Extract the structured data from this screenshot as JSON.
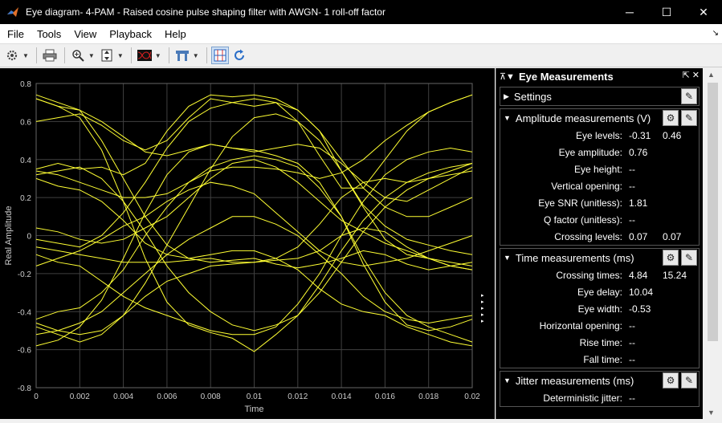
{
  "window": {
    "title": "Eye diagram- 4-PAM - Raised cosine pulse shaping filter with AWGN- 1 roll-off factor",
    "minimize": "─",
    "maximize": "☐",
    "close": "✕"
  },
  "menu": [
    "File",
    "Tools",
    "View",
    "Playback",
    "Help"
  ],
  "menu_overflow": "↘",
  "toolbar": {
    "icons": [
      "gear-icon",
      "print-icon",
      "zoom-in-icon",
      "scale-axes-icon",
      "eye-diagram-style-icon",
      "measurements-icon",
      "eye-measurements-icon",
      "refresh-icon"
    ]
  },
  "chart_data": {
    "type": "line",
    "title": "",
    "xlabel": "Time",
    "ylabel": "Real Amplitude",
    "xlim": [
      0,
      0.02
    ],
    "ylim": [
      -0.8,
      0.8
    ],
    "xticks": [
      "0",
      "0.002",
      "0.004",
      "0.006",
      "0.008",
      "0.01",
      "0.012",
      "0.014",
      "0.016",
      "0.018",
      "0.02"
    ],
    "yticks": [
      "-0.8",
      "-0.6",
      "-0.4",
      "-0.2",
      "0",
      "0.2",
      "0.4",
      "0.6",
      "0.8"
    ],
    "grid": true,
    "background": "#000000",
    "line_color": "#ffff33",
    "levels": [
      -0.46,
      -0.15,
      0.15,
      0.46
    ],
    "x": [
      0,
      0.001,
      0.002,
      0.003,
      0.004,
      0.005,
      0.006,
      0.007,
      0.008,
      0.009,
      0.01,
      0.011,
      0.012,
      0.013,
      0.014,
      0.015,
      0.016,
      0.017,
      0.018,
      0.019,
      0.02
    ],
    "series": [
      {
        "values": [
          0.72,
          0.68,
          0.62,
          0.45,
          0.18,
          -0.12,
          -0.35,
          -0.47,
          -0.51,
          -0.54,
          -0.61,
          -0.52,
          -0.42,
          -0.26,
          -0.08,
          0.08,
          0.2,
          0.28,
          0.33,
          0.36,
          0.38
        ]
      },
      {
        "values": [
          0.74,
          0.7,
          0.66,
          0.5,
          0.3,
          0.1,
          -0.05,
          -0.12,
          -0.14,
          -0.13,
          -0.12,
          -0.15,
          -0.17,
          -0.15,
          -0.12,
          -0.08,
          -0.1,
          -0.15,
          -0.18,
          -0.16,
          -0.14
        ]
      },
      {
        "values": [
          0.72,
          0.68,
          0.66,
          0.6,
          0.52,
          0.44,
          0.42,
          0.45,
          0.48,
          0.46,
          0.45,
          0.42,
          0.38,
          0.28,
          0.1,
          -0.15,
          -0.35,
          -0.47,
          -0.5,
          -0.48,
          -0.44
        ]
      },
      {
        "values": [
          0.6,
          0.62,
          0.64,
          0.58,
          0.5,
          0.45,
          0.5,
          0.62,
          0.72,
          0.7,
          0.68,
          0.7,
          0.6,
          0.42,
          0.25,
          0.25,
          0.4,
          0.55,
          0.65,
          0.7,
          0.74
        ]
      },
      {
        "values": [
          0.35,
          0.38,
          0.35,
          0.36,
          0.32,
          0.38,
          0.55,
          0.68,
          0.74,
          0.73,
          0.74,
          0.72,
          0.66,
          0.55,
          0.34,
          0.16,
          0.05,
          -0.02,
          -0.05,
          -0.08,
          -0.1
        ]
      },
      {
        "values": [
          0.34,
          0.32,
          0.28,
          0.24,
          0.2,
          0.2,
          0.22,
          0.28,
          0.36,
          0.4,
          0.42,
          0.4,
          0.36,
          0.25,
          0.1,
          -0.12,
          -0.3,
          -0.42,
          -0.48,
          -0.52,
          -0.56
        ]
      },
      {
        "values": [
          0.3,
          0.26,
          0.24,
          0.18,
          0.08,
          -0.04,
          -0.1,
          -0.12,
          -0.1,
          -0.08,
          -0.08,
          -0.12,
          -0.18,
          -0.28,
          -0.36,
          -0.4,
          -0.42,
          -0.48,
          -0.52,
          -0.56,
          -0.58
        ]
      },
      {
        "values": [
          0.32,
          0.34,
          0.36,
          0.3,
          0.18,
          0.02,
          -0.16,
          -0.3,
          -0.4,
          -0.47,
          -0.5,
          -0.47,
          -0.42,
          -0.3,
          -0.14,
          0.02,
          0.15,
          0.24,
          0.3,
          0.32,
          0.34
        ]
      },
      {
        "values": [
          0.04,
          0.02,
          -0.02,
          -0.04,
          -0.02,
          0.04,
          0.1,
          0.2,
          0.3,
          0.38,
          0.4,
          0.36,
          0.28,
          0.18,
          0.08,
          0.02,
          -0.04,
          -0.08,
          -0.12,
          -0.16,
          -0.18
        ]
      },
      {
        "values": [
          -0.02,
          -0.04,
          -0.06,
          0.0,
          0.12,
          0.28,
          0.46,
          0.6,
          0.67,
          0.7,
          0.72,
          0.7,
          0.66,
          0.55,
          0.4,
          0.25,
          0.15,
          0.1,
          0.1,
          0.15,
          0.2
        ]
      },
      {
        "values": [
          -0.06,
          -0.08,
          -0.1,
          -0.12,
          -0.14,
          -0.14,
          -0.14,
          -0.13,
          -0.12,
          -0.14,
          -0.14,
          -0.13,
          -0.12,
          -0.08,
          0.0,
          0.04,
          0.02,
          -0.06,
          -0.12,
          -0.16,
          -0.18
        ]
      },
      {
        "values": [
          -0.1,
          -0.14,
          -0.16,
          -0.24,
          -0.32,
          -0.38,
          -0.42,
          -0.46,
          -0.5,
          -0.52,
          -0.52,
          -0.48,
          -0.36,
          -0.2,
          0.0,
          0.18,
          0.32,
          0.4,
          0.44,
          0.46,
          0.44
        ]
      },
      {
        "values": [
          -0.16,
          -0.12,
          -0.08,
          -0.02,
          0.05,
          0.1,
          0.18,
          0.24,
          0.28,
          0.26,
          0.22,
          0.12,
          0.02,
          -0.08,
          -0.14,
          -0.16,
          -0.14,
          -0.12,
          -0.08,
          -0.04,
          0.0
        ]
      },
      {
        "values": [
          -0.44,
          -0.4,
          -0.38,
          -0.3,
          -0.18,
          0.0,
          0.15,
          0.28,
          0.34,
          0.36,
          0.36,
          0.35,
          0.33,
          0.3,
          0.33,
          0.4,
          0.5,
          0.58,
          0.65,
          0.7,
          0.74
        ]
      },
      {
        "values": [
          -0.46,
          -0.5,
          -0.52,
          -0.5,
          -0.42,
          -0.32,
          -0.24,
          -0.2,
          -0.16,
          -0.15,
          -0.14,
          -0.12,
          -0.06,
          0.06,
          0.2,
          0.28,
          0.3,
          0.28,
          0.3,
          0.34,
          0.38
        ]
      },
      {
        "values": [
          -0.48,
          -0.52,
          -0.56,
          -0.52,
          -0.42,
          -0.25,
          -0.05,
          0.15,
          0.35,
          0.52,
          0.62,
          0.64,
          0.6,
          0.5,
          0.34,
          0.15,
          -0.02,
          -0.1,
          -0.12,
          -0.14,
          -0.16
        ]
      },
      {
        "values": [
          -0.52,
          -0.5,
          -0.46,
          -0.4,
          -0.3,
          -0.2,
          -0.1,
          -0.02,
          0.04,
          0.1,
          0.1,
          0.06,
          0.0,
          -0.1,
          -0.2,
          -0.32,
          -0.4,
          -0.44,
          -0.46,
          -0.44,
          -0.42
        ]
      },
      {
        "values": [
          -0.58,
          -0.55,
          -0.48,
          -0.34,
          -0.12,
          0.12,
          0.32,
          0.44,
          0.48,
          0.46,
          0.44,
          0.46,
          0.48,
          0.46,
          0.38,
          0.28,
          0.2,
          0.18,
          0.24,
          0.3,
          0.36
        ]
      }
    ]
  },
  "panel": {
    "title": "Eye Measurements",
    "sections": [
      {
        "title": "Settings",
        "expanded": false,
        "icons": [
          "pencil-icon"
        ],
        "rows": []
      },
      {
        "title": "Amplitude measurements (V)",
        "expanded": true,
        "icons": [
          "gear-icon",
          "pencil-icon"
        ],
        "rows": [
          {
            "label": "Eye levels:",
            "v1": "-0.31",
            "v2": "0.46"
          },
          {
            "label": "Eye amplitude:",
            "v1": "0.76",
            "v2": ""
          },
          {
            "label": "Eye height:",
            "v1": "--",
            "v2": ""
          },
          {
            "label": "Vertical opening:",
            "v1": "--",
            "v2": ""
          },
          {
            "label": "Eye SNR (unitless):",
            "v1": "1.81",
            "v2": ""
          },
          {
            "label": "Q factor (unitless):",
            "v1": "--",
            "v2": ""
          },
          {
            "label": "Crossing levels:",
            "v1": "0.07",
            "v2": "0.07"
          }
        ]
      },
      {
        "title": "Time measurements (ms)",
        "expanded": true,
        "icons": [
          "gear-icon",
          "pencil-icon"
        ],
        "rows": [
          {
            "label": "Crossing times:",
            "v1": "4.84",
            "v2": "15.24"
          },
          {
            "label": "Eye delay:",
            "v1": "10.04",
            "v2": ""
          },
          {
            "label": "Eye width:",
            "v1": "-0.53",
            "v2": ""
          },
          {
            "label": "Horizontal opening:",
            "v1": "--",
            "v2": ""
          },
          {
            "label": "Rise time:",
            "v1": "--",
            "v2": ""
          },
          {
            "label": "Fall time:",
            "v1": "--",
            "v2": ""
          }
        ]
      },
      {
        "title": "Jitter measurements (ms)",
        "expanded": true,
        "icons": [
          "gear-icon",
          "pencil-icon"
        ],
        "rows": [
          {
            "label": "Deterministic jitter:",
            "v1": "--",
            "v2": ""
          }
        ]
      }
    ]
  }
}
